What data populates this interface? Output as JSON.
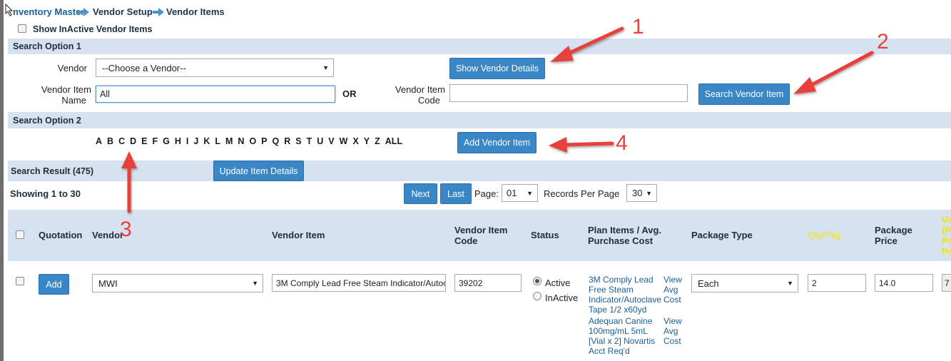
{
  "breadcrumb": {
    "items": [
      "nventory Master",
      "Vendor Setup",
      "Vendor Items"
    ]
  },
  "show_inactive_label": "Show InActive Vendor Items",
  "search_option_1": {
    "title": "Search Option 1",
    "vendor_label": "Vendor",
    "vendor_select_value": "--Choose a Vendor--",
    "show_vendor_details_label": "Show Vendor Details",
    "vendor_item_name_label_line1": "Vendor Item",
    "vendor_item_name_label_line2": "Name",
    "vendor_item_name_value": "All",
    "or_label": "OR",
    "vendor_item_code_label_line1": "Vendor Item",
    "vendor_item_code_label_line2": "Code",
    "vendor_item_code_value": "",
    "search_vendor_item_label": "Search Vendor Item"
  },
  "search_option_2": {
    "title": "Search Option 2",
    "letters": [
      "A",
      "B",
      "C",
      "D",
      "E",
      "F",
      "G",
      "H",
      "I",
      "J",
      "K",
      "L",
      "M",
      "N",
      "O",
      "P",
      "Q",
      "R",
      "S",
      "T",
      "U",
      "V",
      "W",
      "X",
      "Y",
      "Z",
      "ALL"
    ],
    "add_vendor_item_label": "Add Vendor Item"
  },
  "search_result": {
    "title": "Search Result (475)",
    "update_item_details_label": "Update Item Details",
    "showing": "Showing 1 to 30",
    "next_label": "Next",
    "last_label": "Last",
    "page_label": "Page:",
    "page_value": "01",
    "records_label": "Records Per Page",
    "records_value": "30"
  },
  "table": {
    "headers": {
      "quotation": "Quotation",
      "vendor": "Vendor",
      "vendor_item": "Vendor Item",
      "vendor_item_code_1": "Vendor Item",
      "vendor_item_code_2": "Code",
      "status": "Status",
      "plan_items_1": "Plan Items / Avg.",
      "plan_items_2": "Purchase Cost",
      "package_type": "Package Type",
      "qty_pkg": "Qty/Pkg",
      "package_price_1": "Package",
      "package_price_2": "Price",
      "cut_1": "Un",
      "cut_2": "(P",
      "cut_3": "Pr",
      "cut_4": "Pr"
    },
    "row": {
      "add_label": "Add",
      "vendor_value": "MWI",
      "vendor_item_value": "3M Comply Lead Free Steam Indicator/Autoc",
      "code_value": "39202",
      "status_active": "Active",
      "status_inactive": "InActive",
      "plan_items": [
        {
          "lines": [
            "3M Comply Lead",
            "Free Steam",
            "Indicator/Autoclave",
            "Tape 1/2 x60yd"
          ],
          "view": [
            "View",
            "Avg",
            "Cost"
          ]
        },
        {
          "lines": [
            "Adequan Canine",
            "100mg/mL 5mL",
            "[Vial x 2] Novartis",
            "Acct Req'd"
          ],
          "view": [
            "View",
            "Avg",
            "Cost"
          ]
        }
      ],
      "package_type_value": "Each",
      "qty_value": "2",
      "price_value": "14.0",
      "cut_value": "7"
    }
  },
  "annotations": [
    "1",
    "2",
    "3",
    "4"
  ],
  "colors": {
    "accent_button": "#3a87c8",
    "band": "#d6e2ef",
    "annotation_red": "#e8403a",
    "qty_header_yellow": "#f5e600"
  }
}
